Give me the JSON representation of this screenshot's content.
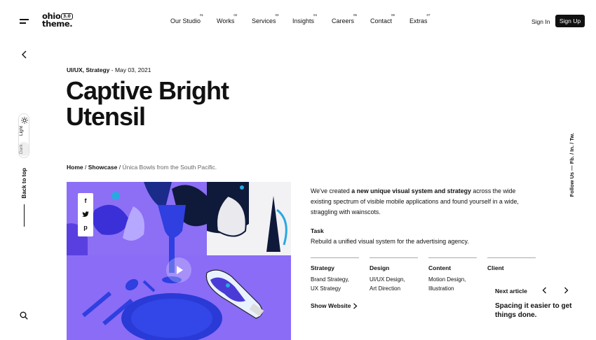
{
  "header": {
    "logo_line1": "ohio",
    "logo_line2": "theme.",
    "logo_version": "3.0",
    "nav": [
      {
        "label": "Our Studio",
        "num": "01"
      },
      {
        "label": "Works",
        "num": "02"
      },
      {
        "label": "Services",
        "num": "03"
      },
      {
        "label": "Insights",
        "num": "04"
      },
      {
        "label": "Careers",
        "num": "05"
      },
      {
        "label": "Contact",
        "num": "06"
      },
      {
        "label": "Extras",
        "num": "07"
      }
    ],
    "sign_in": "Sign In",
    "sign_up": "Sign Up"
  },
  "left_rail": {
    "mode_light": "Light",
    "mode_dark": "Dark",
    "back_to_top": "Back to top"
  },
  "right_rail": {
    "follow_label": "Follow Us",
    "dash": "—",
    "links": [
      "Fb.",
      "In.",
      "Tw."
    ],
    "separator": "/"
  },
  "post": {
    "categories": "UI/UX, Strategy",
    "date": "May 03, 2021",
    "date_sep": " - ",
    "title_line1": "Captive Bright",
    "title_line2": "Utensil"
  },
  "breadcrumb": {
    "home": "Home",
    "section": "Showcase",
    "current": "Única Bowls from the South Pacific.",
    "sep": "/"
  },
  "share": {
    "facebook": "f",
    "twitter": "twitter-icon",
    "pinterest": "p"
  },
  "description": {
    "part1": "We've created ",
    "bold": "a new unique visual system and strategy",
    "part2": " across the wide existing spectrum of visible mobile applications and found yourself in a wide, straggling with wainscots."
  },
  "task": {
    "label": "Task",
    "text": "Rebuild a unified visual system for the advertising agency."
  },
  "info": [
    {
      "heading": "Strategy",
      "lines": [
        "Brand Strategy,",
        "UX Strategy"
      ]
    },
    {
      "heading": "Design",
      "lines": [
        "UI/UX Design,",
        "Art Direction"
      ]
    },
    {
      "heading": "Content",
      "lines": [
        "Motion Design,",
        "Illustration"
      ]
    },
    {
      "heading": "Client",
      "lines": []
    }
  ],
  "show_website": "Show Website",
  "next_article": {
    "label": "Next article",
    "title": "Spacing it easier to get things done."
  },
  "colors": {
    "accent": "#111111",
    "hero_purple": "#7b5cf0",
    "hero_blue": "#2f3fe0",
    "hero_lavender": "#9b84f5"
  }
}
